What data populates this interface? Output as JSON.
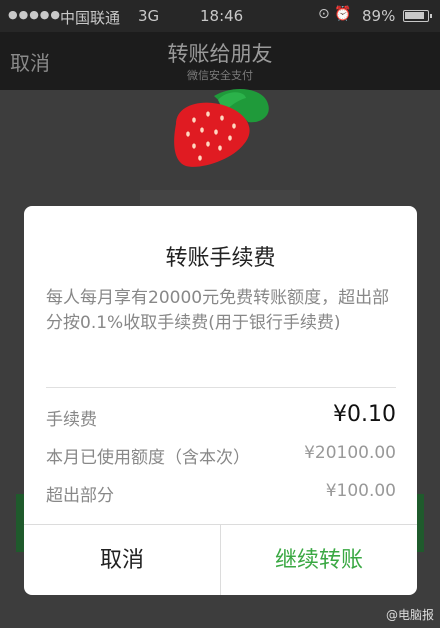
{
  "status_bar": {
    "carrier": "中国联通",
    "network": "3G",
    "time": "18:46",
    "battery": "89%"
  },
  "nav": {
    "cancel_label": "取消",
    "title": "转账给朋友",
    "subtitle": "微信安全支付"
  },
  "dialog": {
    "title": "转账手续费",
    "description": "每人每月享有20000元免费转账额度，超出部分按0.1%收取手续费(用于银行手续费)",
    "fee_label": "手续费",
    "fee_value": "¥0.10",
    "used_label": "本月已使用额度（含本次）",
    "used_value": "¥20100.00",
    "exceed_label": "超出部分",
    "exceed_value": "¥100.00",
    "cancel_button": "取消",
    "continue_button": "继续转账"
  },
  "watermark": "@电脑报",
  "colors": {
    "accent_green": "#3aa843",
    "nav_bg": "#1c1c1c"
  }
}
